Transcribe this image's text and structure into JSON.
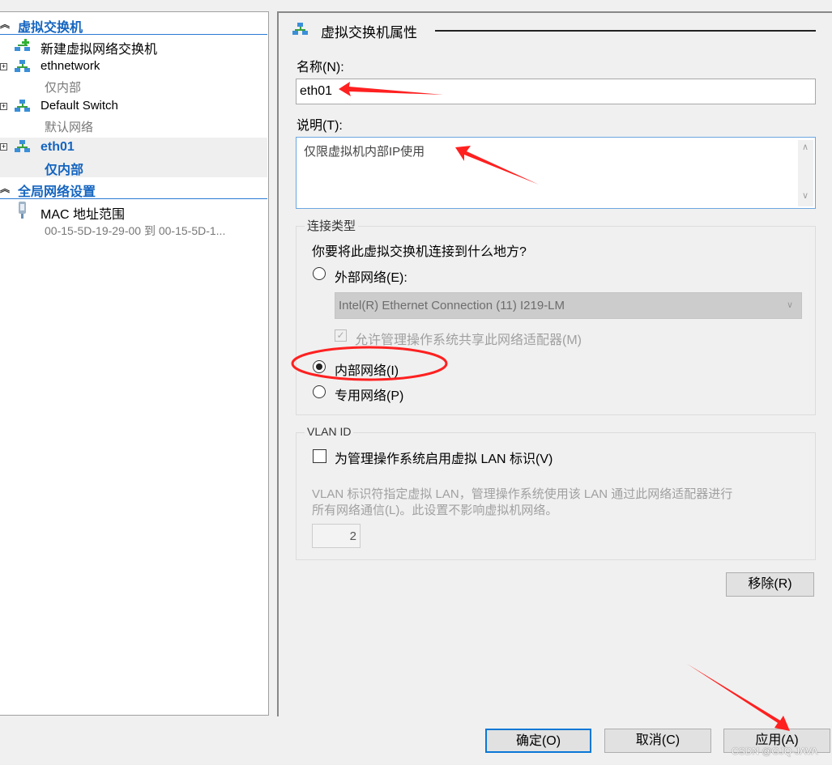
{
  "sidebar": {
    "section1": "虚拟交换机",
    "new_switch": "新建虚拟网络交换机",
    "switches": [
      {
        "name": "ethnetwork",
        "type": "仅内部"
      },
      {
        "name": "Default Switch",
        "type": "默认网络"
      },
      {
        "name": "eth01",
        "type": "仅内部",
        "selected": true
      }
    ],
    "section2": "全局网络设置",
    "mac_label": "MAC 地址范围",
    "mac_value": "00-15-5D-19-29-00 到 00-15-5D-1..."
  },
  "props": {
    "title": "虚拟交换机属性",
    "name_label": "名称(N):",
    "name_value": "eth01",
    "desc_label": "说明(T):",
    "desc_value": "仅限虚拟机内部IP使用",
    "conn_group": "连接类型",
    "conn_question": "你要将此虚拟交换机连接到什么地方?",
    "external": "外部网络(E):",
    "adapter": "Intel(R) Ethernet Connection (11) I219-LM",
    "allow_share": "允许管理操作系统共享此网络适配器(M)",
    "internal": "内部网络(I)",
    "private": "专用网络(P)",
    "selected_connection": "internal",
    "vlan_group": "VLAN ID",
    "vlan_enable": "为管理操作系统启用虚拟 LAN 标识(V)",
    "vlan_desc1": "VLAN 标识符指定虚拟 LAN，管理操作系统使用该 LAN 通过此网络适配器进行",
    "vlan_desc2": "所有网络通信(L)。此设置不影响虚拟机网络。",
    "vlan_value": "2",
    "remove": "移除(R)"
  },
  "footer": {
    "ok": "确定(O)",
    "cancel": "取消(C)",
    "apply": "应用(A)"
  },
  "watermark": "CSDN @GJQ-JAVA",
  "colors": {
    "accent": "#1565c0",
    "annotation": "#ff2020"
  }
}
